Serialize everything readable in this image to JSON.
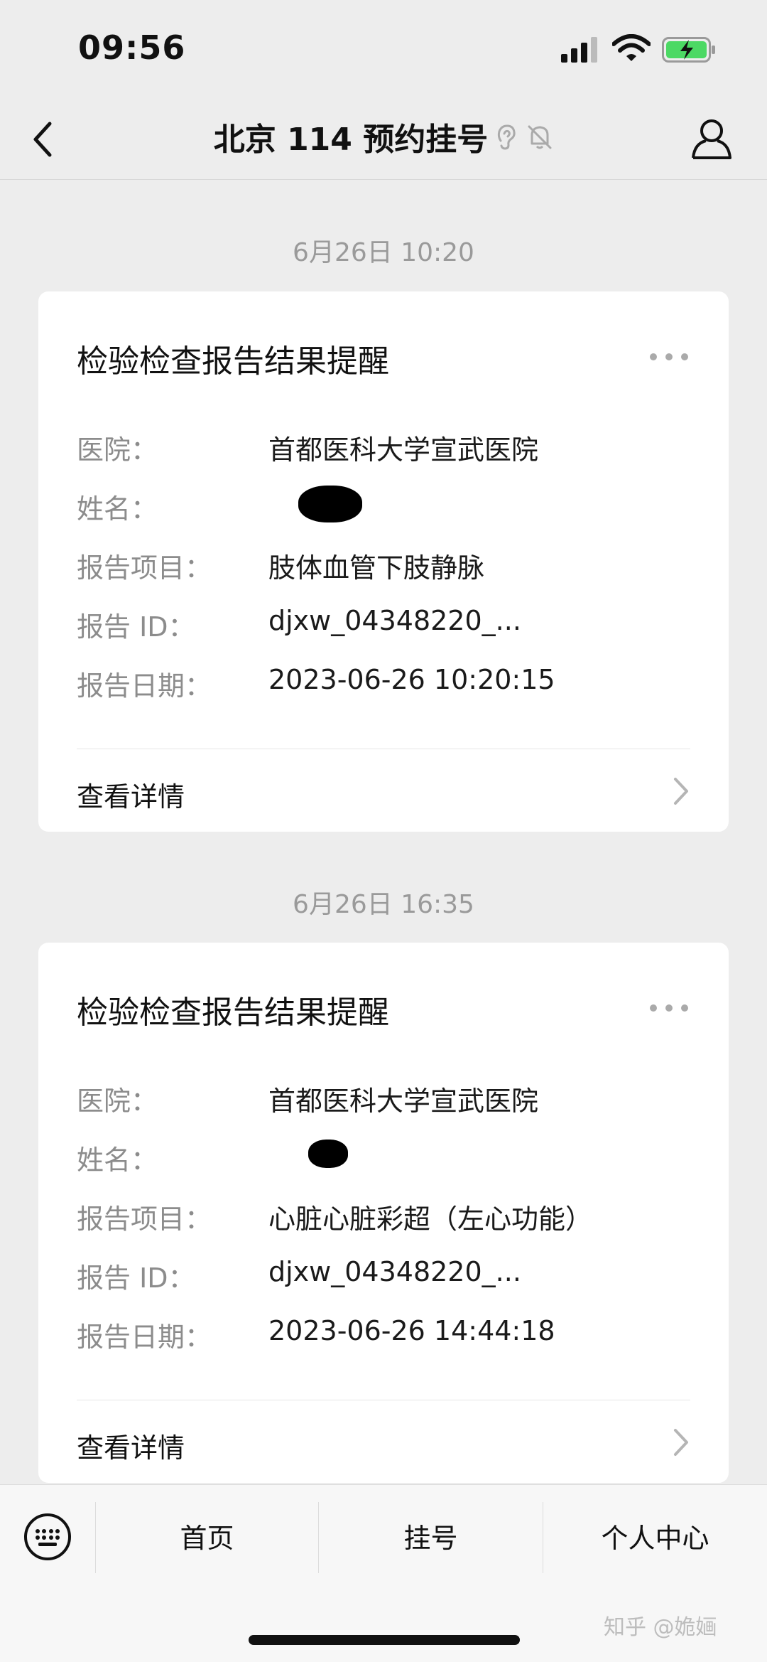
{
  "status_bar": {
    "time": "09:56",
    "battery_color": "#4cd964"
  },
  "nav": {
    "title": "北京 114 预约挂号"
  },
  "messages": [
    {
      "timestamp": "6月26日 10:20",
      "title": "检验检查报告结果提醒",
      "rows": [
        {
          "label": "医院：",
          "value": "首都医科大学宣武医院"
        },
        {
          "label": "姓名：",
          "value": ""
        },
        {
          "label": "报告项目：",
          "value": "肢体血管下肢静脉"
        },
        {
          "label": "报告 ID：",
          "value": "djxw_04348220_..."
        },
        {
          "label": "报告日期：",
          "value": "2023-06-26 10:20:15"
        }
      ],
      "link": "查看详情"
    },
    {
      "timestamp": "6月26日 16:35",
      "title": "检验检查报告结果提醒",
      "rows": [
        {
          "label": "医院：",
          "value": "首都医科大学宣武医院"
        },
        {
          "label": "姓名：",
          "value": ""
        },
        {
          "label": "报告项目：",
          "value": "心脏心脏彩超（左心功能）"
        },
        {
          "label": "报告 ID：",
          "value": "djxw_04348220_..."
        },
        {
          "label": "报告日期：",
          "value": "2023-06-26 14:44:18"
        }
      ],
      "link": "查看详情"
    }
  ],
  "bottom_menu": {
    "items": [
      "首页",
      "挂号",
      "个人中心"
    ]
  },
  "watermark": "知乎 @姽婳"
}
